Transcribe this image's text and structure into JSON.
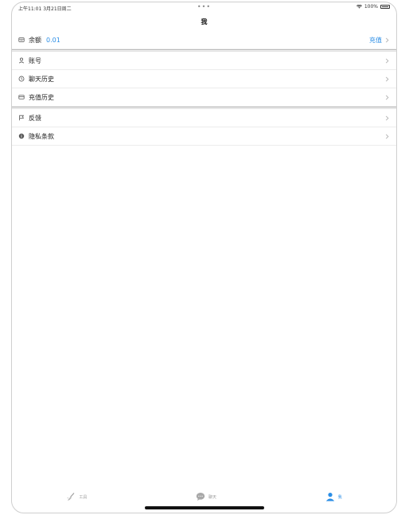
{
  "status_bar": {
    "time_date": "上午11:01 3月21日周二",
    "dots": "•••",
    "battery": "100%"
  },
  "nav": {
    "title": "我"
  },
  "balance_row": {
    "label": "余额",
    "value": "0.01",
    "action": "充值",
    "icon": "wallet-icon"
  },
  "menu_group_1": [
    {
      "label": "账号",
      "icon": "person-icon"
    },
    {
      "label": "聊天历史",
      "icon": "clock-icon"
    },
    {
      "label": "充值历史",
      "icon": "card-icon"
    }
  ],
  "menu_group_2": [
    {
      "label": "反馈",
      "icon": "flag-icon"
    },
    {
      "label": "隐私条款",
      "icon": "info-icon"
    }
  ],
  "tabs": [
    {
      "label": "工具",
      "icon": "broom-icon",
      "active": false
    },
    {
      "label": "聊天",
      "icon": "chat-bubble-icon",
      "active": false
    },
    {
      "label": "我",
      "icon": "person-icon",
      "active": true
    }
  ],
  "colors": {
    "accent": "#2b8ee6",
    "inactive": "#9a9a9a"
  }
}
